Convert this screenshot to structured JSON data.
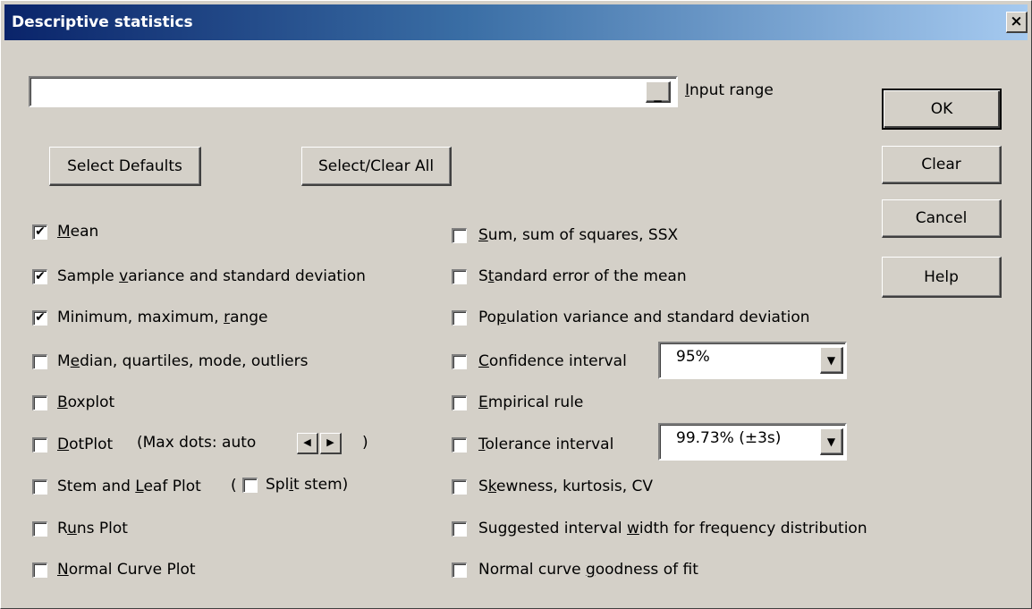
{
  "window": {
    "title": "Descriptive statistics",
    "close_label": "×"
  },
  "input": {
    "value": "",
    "label_pre": "",
    "label_ul": "I",
    "label_post": "nput range",
    "collapse_label": "_"
  },
  "buttons": {
    "ok": "OK",
    "clear": "Clear",
    "cancel": "Cancel",
    "help": "Help",
    "select_defaults": "Select Defaults",
    "select_clear_all": "Select/Clear All"
  },
  "left_options": [
    {
      "pre": "",
      "ul": "M",
      "post": "ean",
      "checked": true
    },
    {
      "pre": "Sample ",
      "ul": "v",
      "post": "ariance and standard deviation",
      "checked": true
    },
    {
      "pre": "Minimum, maximum, ",
      "ul": "r",
      "post": "ange",
      "checked": true
    },
    {
      "pre": "M",
      "ul": "e",
      "post": "dian, quartiles, mode, outliers",
      "checked": false
    },
    {
      "pre": "",
      "ul": "B",
      "post": "oxplot",
      "checked": false
    },
    {
      "pre": "",
      "ul": "D",
      "post": "otPlot",
      "checked": false
    },
    {
      "pre": "Stem and ",
      "ul": "L",
      "post": "eaf Plot",
      "checked": false
    },
    {
      "pre": "R",
      "ul": "u",
      "post": "ns Plot",
      "checked": false
    },
    {
      "pre": "",
      "ul": "N",
      "post": "ormal Curve Plot",
      "checked": false
    }
  ],
  "dotplot": {
    "max_dots_text": "(Max dots: auto",
    "close_paren": ")",
    "left_arrow": "◀",
    "right_arrow": "▶"
  },
  "stem_leaf": {
    "open_paren": "(",
    "split_pre": "Spl",
    "split_ul": "i",
    "split_post": "t stem)",
    "split_checked": false
  },
  "right_options": [
    {
      "pre": "",
      "ul": "S",
      "post": "um, sum of squares, SSX",
      "checked": false
    },
    {
      "pre": "S",
      "ul": "t",
      "post": "andard error of the mean",
      "checked": false
    },
    {
      "pre": "Po",
      "ul": "p",
      "post": "ulation variance and standard deviation",
      "checked": false
    },
    {
      "pre": "",
      "ul": "C",
      "post": "onfidence interval",
      "checked": false
    },
    {
      "pre": "",
      "ul": "E",
      "post": "mpirical rule",
      "checked": false
    },
    {
      "pre": "",
      "ul": "T",
      "post": "olerance interval",
      "checked": false
    },
    {
      "pre": "S",
      "ul": "k",
      "post": "ewness, kurtosis, CV",
      "checked": false
    },
    {
      "pre": "Suggested interval ",
      "ul": "w",
      "post": "idth for frequency distribution",
      "checked": false
    },
    {
      "pre": "Normal curve ",
      "ul": "g",
      "post": "oodness of fit",
      "checked": false
    }
  ],
  "confidence_select": {
    "value": "95%"
  },
  "tolerance_select": {
    "value": "99.73% (±3s)"
  },
  "check_glyph": "✔",
  "dropdown_glyph": "▼"
}
